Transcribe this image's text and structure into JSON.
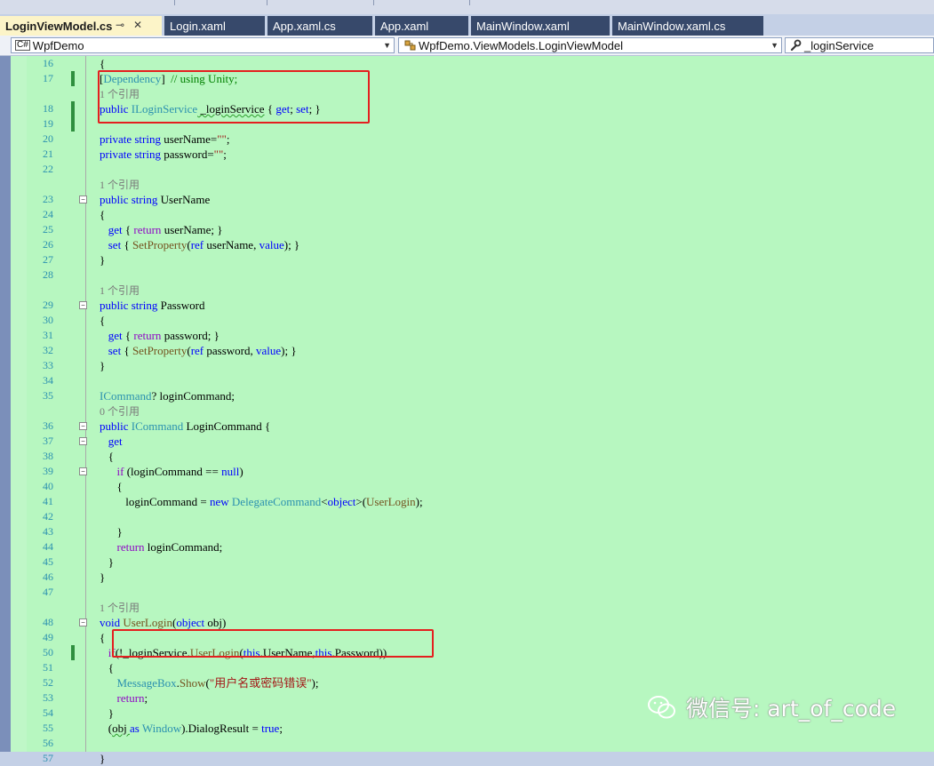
{
  "tabs": [
    {
      "label": "LoginViewModel.cs",
      "active": true
    },
    {
      "label": "Login.xaml"
    },
    {
      "label": "App.xaml.cs"
    },
    {
      "label": "App.xaml"
    },
    {
      "label": "MainWindow.xaml"
    },
    {
      "label": "MainWindow.xaml.cs"
    }
  ],
  "tab_icons": {
    "pin": "⊸",
    "close": "✕"
  },
  "nav": {
    "project": "WpfDemo",
    "project_icon": "C#",
    "class_path": "WpfDemo.ViewModels.LoginViewModel",
    "member": "_loginService",
    "member_icon": "wrench-icon"
  },
  "lines": [
    {
      "n": "16",
      "t": [
        [
          "p",
          "{"
        ]
      ]
    },
    {
      "n": "17",
      "t": [
        [
          "p",
          "["
        ],
        [
          "ty",
          "Dependency"
        ],
        [
          "p",
          "]  "
        ],
        [
          "cmt",
          "// using Unity;"
        ]
      ],
      "chg": true
    },
    {
      "n": "",
      "t": [
        [
          "ref",
          "1 个引用"
        ]
      ]
    },
    {
      "n": "18",
      "t": [
        [
          "kw",
          "public "
        ],
        [
          "ty",
          "ILoginService"
        ],
        [
          "sq",
          " _loginService"
        ],
        [
          "p",
          " { "
        ],
        [
          "kw",
          "get"
        ],
        [
          "p",
          "; "
        ],
        [
          "kw",
          "set"
        ],
        [
          "p",
          "; }"
        ]
      ],
      "chg": true
    },
    {
      "n": "19",
      "t": [],
      "chg": true
    },
    {
      "n": "20",
      "t": [
        [
          "kw",
          "private "
        ],
        [
          "kw",
          "string "
        ],
        [
          "p",
          "userName="
        ],
        [
          "str",
          "\"\""
        ],
        [
          "p",
          ";"
        ]
      ]
    },
    {
      "n": "21",
      "t": [
        [
          "kw",
          "private "
        ],
        [
          "kw",
          "string "
        ],
        [
          "p",
          "password="
        ],
        [
          "str",
          "\"\""
        ],
        [
          "p",
          ";"
        ]
      ]
    },
    {
      "n": "22",
      "t": []
    },
    {
      "n": "",
      "t": [
        [
          "ref",
          "1 个引用"
        ]
      ]
    },
    {
      "n": "23",
      "t": [
        [
          "kw",
          "public "
        ],
        [
          "kw",
          "string "
        ],
        [
          "p",
          "UserName"
        ]
      ],
      "fold": "-"
    },
    {
      "n": "24",
      "t": [
        [
          "p",
          "{"
        ]
      ]
    },
    {
      "n": "25",
      "t": [
        [
          "p",
          "   "
        ],
        [
          "kw",
          "get"
        ],
        [
          "p",
          " { "
        ],
        [
          "ctl",
          "return "
        ],
        [
          "p",
          "userName; }"
        ]
      ]
    },
    {
      "n": "26",
      "t": [
        [
          "p",
          "   "
        ],
        [
          "kw",
          "set"
        ],
        [
          "p",
          " { "
        ],
        [
          "fn",
          "SetProperty"
        ],
        [
          "p",
          "("
        ],
        [
          "kw",
          "ref "
        ],
        [
          "p",
          "userName, "
        ],
        [
          "kw",
          "value"
        ],
        [
          "p",
          "); }"
        ]
      ]
    },
    {
      "n": "27",
      "t": [
        [
          "p",
          "}"
        ]
      ]
    },
    {
      "n": "28",
      "t": []
    },
    {
      "n": "",
      "t": [
        [
          "ref",
          "1 个引用"
        ]
      ]
    },
    {
      "n": "29",
      "t": [
        [
          "kw",
          "public "
        ],
        [
          "kw",
          "string "
        ],
        [
          "p",
          "Password"
        ]
      ],
      "fold": "-"
    },
    {
      "n": "30",
      "t": [
        [
          "p",
          "{"
        ]
      ]
    },
    {
      "n": "31",
      "t": [
        [
          "p",
          "   "
        ],
        [
          "kw",
          "get"
        ],
        [
          "p",
          " { "
        ],
        [
          "ctl",
          "return "
        ],
        [
          "p",
          "password; }"
        ]
      ]
    },
    {
      "n": "32",
      "t": [
        [
          "p",
          "   "
        ],
        [
          "kw",
          "set"
        ],
        [
          "p",
          " { "
        ],
        [
          "fn",
          "SetProperty"
        ],
        [
          "p",
          "("
        ],
        [
          "kw",
          "ref "
        ],
        [
          "p",
          "password, "
        ],
        [
          "kw",
          "value"
        ],
        [
          "p",
          "); }"
        ]
      ]
    },
    {
      "n": "33",
      "t": [
        [
          "p",
          "}"
        ]
      ]
    },
    {
      "n": "34",
      "t": []
    },
    {
      "n": "35",
      "t": [
        [
          "ty",
          "ICommand"
        ],
        [
          "p",
          "? loginCommand;"
        ]
      ]
    },
    {
      "n": "",
      "t": [
        [
          "ref",
          "0 个引用"
        ]
      ]
    },
    {
      "n": "36",
      "t": [
        [
          "kw",
          "public "
        ],
        [
          "ty",
          "ICommand "
        ],
        [
          "p",
          "LoginCommand {"
        ]
      ],
      "fold": "-"
    },
    {
      "n": "37",
      "t": [
        [
          "p",
          "   "
        ],
        [
          "kw",
          "get"
        ]
      ],
      "fold": "-"
    },
    {
      "n": "38",
      "t": [
        [
          "p",
          "   {"
        ]
      ]
    },
    {
      "n": "39",
      "t": [
        [
          "p",
          "      "
        ],
        [
          "ctl",
          "if"
        ],
        [
          "p",
          " (loginCommand == "
        ],
        [
          "kw",
          "null"
        ],
        [
          "p",
          ")"
        ]
      ],
      "fold": "-"
    },
    {
      "n": "40",
      "t": [
        [
          "p",
          "      {"
        ]
      ]
    },
    {
      "n": "41",
      "t": [
        [
          "p",
          "         loginCommand = "
        ],
        [
          "kw",
          "new "
        ],
        [
          "ty",
          "DelegateCommand"
        ],
        [
          "p",
          "<"
        ],
        [
          "kw",
          "object"
        ],
        [
          "p",
          ">("
        ],
        [
          "fn",
          "UserLogin"
        ],
        [
          "p",
          ");"
        ]
      ]
    },
    {
      "n": "42",
      "t": []
    },
    {
      "n": "43",
      "t": [
        [
          "p",
          "      }"
        ]
      ]
    },
    {
      "n": "44",
      "t": [
        [
          "p",
          "      "
        ],
        [
          "ctl",
          "return "
        ],
        [
          "p",
          "loginCommand;"
        ]
      ]
    },
    {
      "n": "45",
      "t": [
        [
          "p",
          "   }"
        ]
      ]
    },
    {
      "n": "46",
      "t": [
        [
          "p",
          "}"
        ]
      ]
    },
    {
      "n": "47",
      "t": []
    },
    {
      "n": "",
      "t": [
        [
          "ref",
          "1 个引用"
        ]
      ]
    },
    {
      "n": "48",
      "t": [
        [
          "kw",
          "void "
        ],
        [
          "fn",
          "UserLogin"
        ],
        [
          "p",
          "("
        ],
        [
          "kw",
          "object "
        ],
        [
          "p",
          "obj)"
        ]
      ],
      "fold": "-"
    },
    {
      "n": "49",
      "t": [
        [
          "p",
          "{"
        ]
      ]
    },
    {
      "n": "50",
      "t": [
        [
          "p",
          "   "
        ],
        [
          "ctl",
          "if"
        ],
        [
          "p",
          "(!_loginService."
        ],
        [
          "fn",
          "UserLogin"
        ],
        [
          "p",
          "("
        ],
        [
          "kw",
          "this"
        ],
        [
          "p",
          ".UserName,"
        ],
        [
          "kw",
          "this"
        ],
        [
          "p",
          ".Password))"
        ]
      ],
      "chg": true
    },
    {
      "n": "51",
      "t": [
        [
          "p",
          "   {"
        ]
      ]
    },
    {
      "n": "52",
      "t": [
        [
          "p",
          "      "
        ],
        [
          "ty",
          "MessageBox"
        ],
        [
          "p",
          "."
        ],
        [
          "fn",
          "Show"
        ],
        [
          "p",
          "("
        ],
        [
          "str",
          "\"用户名或密码错误\""
        ],
        [
          "p",
          ");"
        ]
      ]
    },
    {
      "n": "53",
      "t": [
        [
          "p",
          "      "
        ],
        [
          "ctl",
          "return"
        ],
        [
          "p",
          ";"
        ]
      ]
    },
    {
      "n": "54",
      "t": [
        [
          "p",
          "   }"
        ]
      ]
    },
    {
      "n": "55",
      "t": [
        [
          "p",
          "   ("
        ],
        [
          "sq",
          "obj "
        ],
        [
          "kw",
          "as "
        ],
        [
          "ty",
          "Window"
        ],
        [
          "p",
          ").DialogResult = "
        ],
        [
          "kw",
          "true"
        ],
        [
          "p",
          ";"
        ]
      ]
    },
    {
      "n": "56",
      "t": []
    },
    {
      "n": "57",
      "t": [
        [
          "p",
          "}"
        ]
      ]
    }
  ],
  "watermark": {
    "text": "微信号: art_of_code",
    "icon": "wechat-icon"
  },
  "colors": {
    "editor_bg": "#b7f7c0",
    "tab_bg": "#37496b",
    "active_tab_bg": "#fcf4c8",
    "highlight_box": "#e41f1f"
  }
}
